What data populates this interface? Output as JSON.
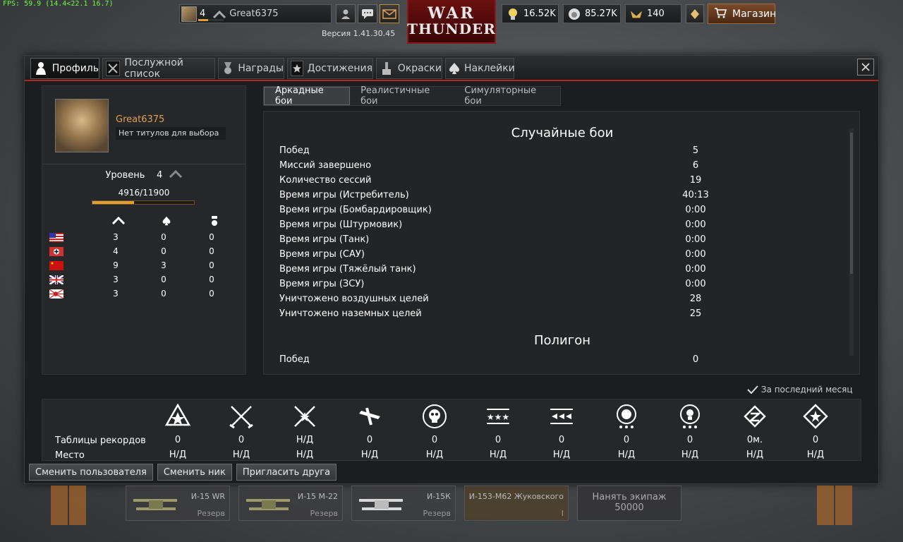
{
  "fps": "FPS: 59.9 (14.4<22.1 16.7)",
  "top": {
    "player_level": "4",
    "player_name": "Great6375",
    "version": "Версия 1.41.30.45",
    "logo_line1": "WAR",
    "logo_line2": "THUNDER",
    "silver_lions": "16.52K",
    "research": "85.27K",
    "golden_eagles": "140",
    "shop_label": "Магазин"
  },
  "tabs": [
    {
      "label": "Профиль",
      "icon": "soldier-icon"
    },
    {
      "label": "Послужной список",
      "icon": "crossed-planes-icon"
    },
    {
      "label": "Награды",
      "icon": "medal-icon"
    },
    {
      "label": "Достижения",
      "icon": "star-icon"
    },
    {
      "label": "Окраски",
      "icon": "paint-icon"
    },
    {
      "label": "Наклейки",
      "icon": "spade-icon"
    }
  ],
  "profile": {
    "name": "Great6375",
    "title_placeholder": "Нет титулов для выбора",
    "level_label": "Уровень",
    "level": "4",
    "xp": "4916/11900",
    "xp_fraction": 0.413,
    "countries": [
      {
        "flag": "usa",
        "a": "3",
        "b": "0",
        "c": "0"
      },
      {
        "flag": "germany",
        "a": "4",
        "b": "0",
        "c": "0"
      },
      {
        "flag": "ussr",
        "a": "9",
        "b": "3",
        "c": "0"
      },
      {
        "flag": "britain",
        "a": "3",
        "b": "0",
        "c": "0"
      },
      {
        "flag": "japan",
        "a": "3",
        "b": "0",
        "c": "0"
      }
    ]
  },
  "modes": [
    "Аркадные бои",
    "Реалистичные бои",
    "Симуляторные бои"
  ],
  "stats": {
    "section1": "Случайные бои",
    "rows": [
      {
        "k": "Побед",
        "v": "5"
      },
      {
        "k": "Миссий завершено",
        "v": "6"
      },
      {
        "k": "Количество сессий",
        "v": "19"
      },
      {
        "k": "Время игры (Истребитель)",
        "v": "40:13"
      },
      {
        "k": "Время игры (Бомбардировщик)",
        "v": "0:00"
      },
      {
        "k": "Время игры (Штурмовик)",
        "v": "0:00"
      },
      {
        "k": "Время игры (Танк)",
        "v": "0:00"
      },
      {
        "k": "Время игры (САУ)",
        "v": "0:00"
      },
      {
        "k": "Время игры (Тяжёлый танк)",
        "v": "0:00"
      },
      {
        "k": "Время игры (ЗСУ)",
        "v": "0:00"
      },
      {
        "k": "Уничтожено воздушных целей",
        "v": "28"
      },
      {
        "k": "Уничтожено наземных целей",
        "v": "25"
      }
    ],
    "section2": "Полигон",
    "partial_row": {
      "k": "Побед",
      "v": "0"
    }
  },
  "last_month": "За последний месяц",
  "leaderboard": {
    "row1_label": "Таблицы рекордов",
    "row2_label": "Место",
    "cols": [
      {
        "icon": "rank-star-icon",
        "v1": "0",
        "v2": "Н/Д"
      },
      {
        "icon": "crossed-swords-icon",
        "v1": "0",
        "v2": "Н/Д"
      },
      {
        "icon": "crossed-swords-star-icon",
        "v1": "Н/Д",
        "v2": "Н/Д"
      },
      {
        "icon": "plane-kill-icon",
        "v1": "0",
        "v2": "Н/Д"
      },
      {
        "icon": "skull-icon",
        "v1": "0",
        "v2": "Н/Д"
      },
      {
        "icon": "three-stars-icon",
        "v1": "0",
        "v2": "Н/Д"
      },
      {
        "icon": "wings-icon",
        "v1": "0",
        "v2": "Н/Д"
      },
      {
        "icon": "lion-icon",
        "v1": "0",
        "v2": "Н/Д"
      },
      {
        "icon": "bulb-icon",
        "v1": "0",
        "v2": "Н/Д"
      },
      {
        "icon": "clock-badge-icon",
        "v1": "0м.",
        "v2": "Н/Д"
      },
      {
        "icon": "diamond-star-icon",
        "v1": "0",
        "v2": "Н/Д"
      }
    ]
  },
  "buttons": {
    "switch_user": "Сменить пользователя",
    "change_nick": "Сменить ник",
    "invite": "Пригласить друга"
  },
  "hangar": {
    "slots": [
      {
        "name": "И-15 WR",
        "status": "Резерв"
      },
      {
        "name": "И-15 М-22",
        "status": "Резерв"
      },
      {
        "name": "И-15К",
        "status": "Резерв"
      },
      {
        "name": "И-153-М62 Жуковского",
        "status": "I"
      }
    ],
    "crew_label": "Нанять экипаж",
    "crew_cost": "50000"
  }
}
